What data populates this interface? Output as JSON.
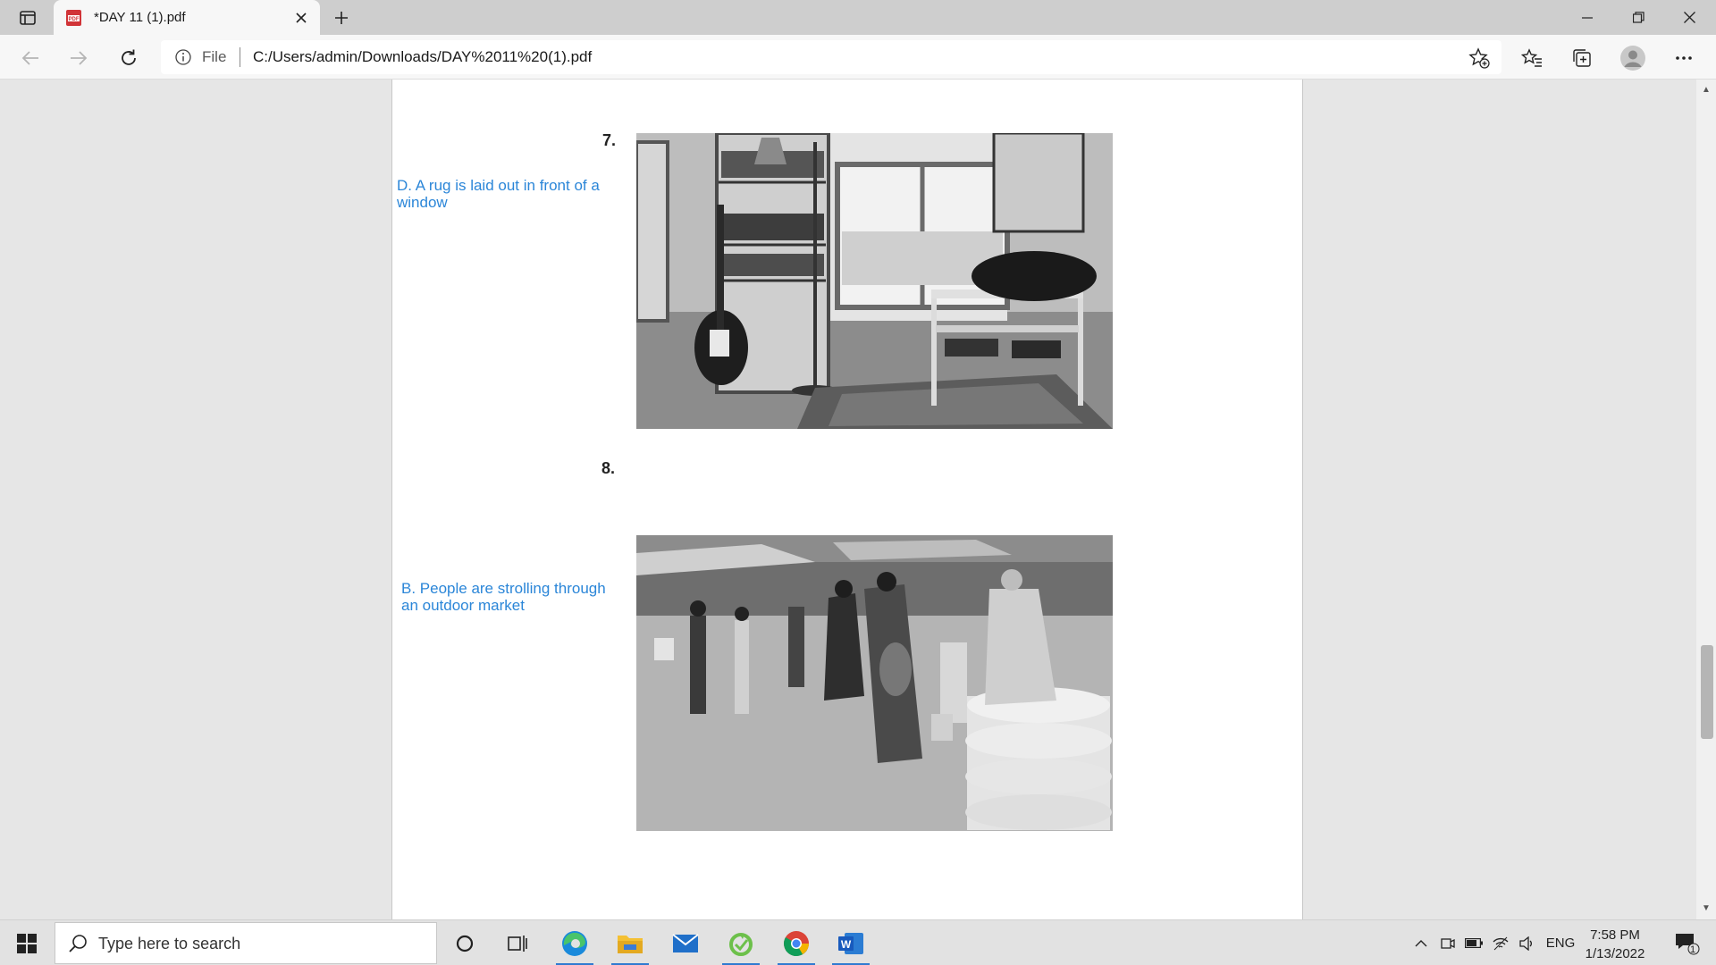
{
  "browser": {
    "tab_title": "*DAY 11 (1).pdf",
    "address": {
      "scheme_label": "File",
      "url": "C:/Users/admin/Downloads/DAY%2011%20(1).pdf"
    }
  },
  "document": {
    "questions": [
      {
        "number": "7.",
        "annotation": "D. A rug is laid out in front of a window"
      },
      {
        "number": "8.",
        "annotation": "B. People are strolling through an outdoor market"
      }
    ]
  },
  "taskbar": {
    "search_placeholder": "Type here to search",
    "apps": [
      "cortana",
      "task-view",
      "edge",
      "file-explorer",
      "mail",
      "green-app",
      "chrome",
      "word"
    ],
    "tray": {
      "language": "ENG",
      "time": "7:58 PM",
      "date": "1/13/2022",
      "notification_count": "1"
    }
  },
  "colors": {
    "annotation": "#2b86d8",
    "taskbar_accent": "#2f7ad1"
  }
}
